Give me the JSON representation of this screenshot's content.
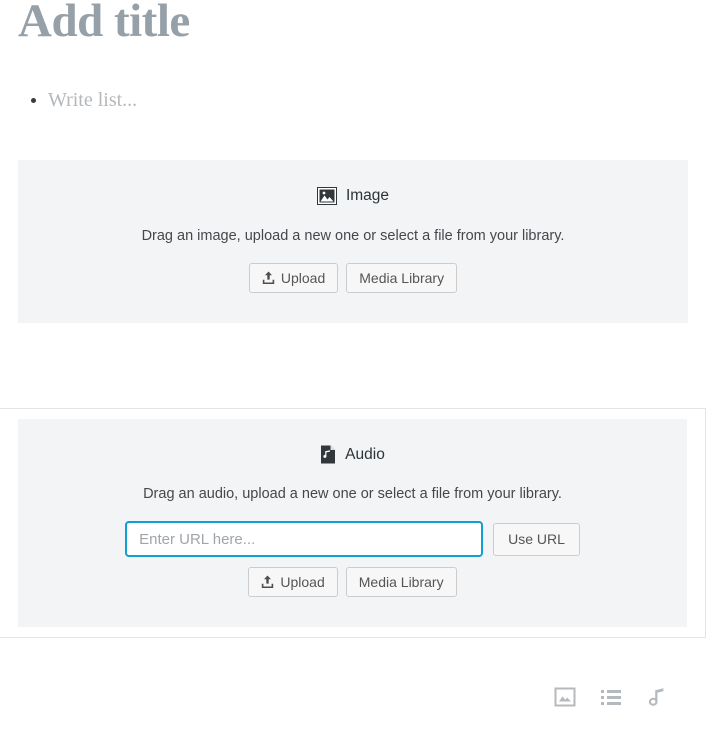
{
  "editor": {
    "title_placeholder": "Add title",
    "list_placeholder": "Write list..."
  },
  "blocks": [
    {
      "id": "image",
      "icon": "image-icon",
      "label": "Image",
      "instructions": "Drag an image, upload a new one or select a file from your library.",
      "upload_label": "Upload",
      "media_library_label": "Media Library",
      "selected": false
    },
    {
      "id": "audio",
      "icon": "audio-icon",
      "label": "Audio",
      "instructions": "Drag an audio, upload a new one or select a file from your library.",
      "url_placeholder": "Enter URL here...",
      "url_value": "",
      "use_url_label": "Use URL",
      "upload_label": "Upload",
      "media_library_label": "Media Library",
      "selected": true
    }
  ],
  "bottom_toolbar": {
    "items": [
      {
        "name": "insert-image-icon",
        "title": "Image"
      },
      {
        "name": "insert-list-icon",
        "title": "List"
      },
      {
        "name": "insert-audio-icon",
        "title": "Audio"
      }
    ]
  },
  "colors": {
    "accent": "#11a0d2",
    "placeholder_bg": "#f3f4f5",
    "title_text": "#96a0a8",
    "toolbar_icon": "#b4b9be",
    "block_border": "#e2e4e7"
  }
}
